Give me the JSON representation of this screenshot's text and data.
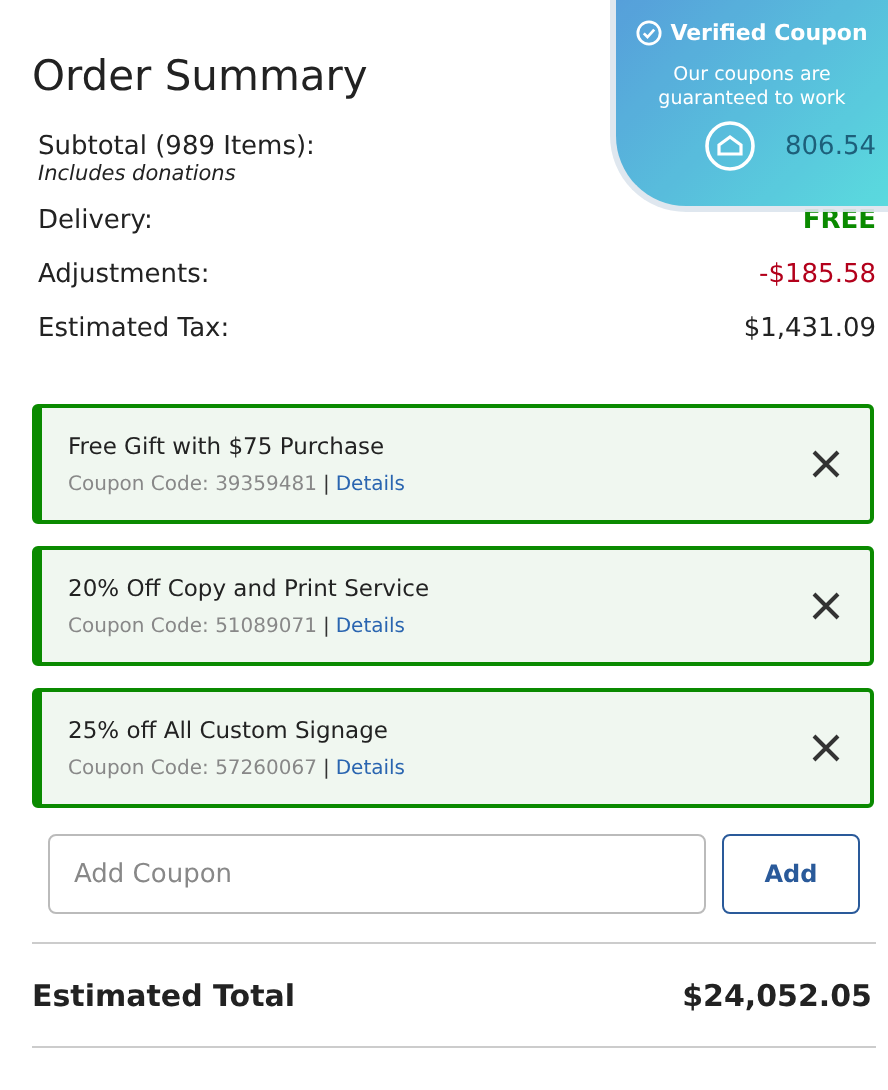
{
  "title": "Order Summary",
  "badge": {
    "title": "Verified Coupon",
    "text": "Our coupons are guaranteed to work"
  },
  "lines": [
    {
      "label": "Subtotal (989 Items):",
      "note": "Includes donations",
      "value": "806.54",
      "kind": "covered"
    },
    {
      "label": "Delivery:",
      "value": "FREE",
      "kind": "free"
    },
    {
      "label": "Adjustments:",
      "value": "-$185.58",
      "kind": "discount"
    },
    {
      "label": "Estimated Tax:",
      "value": "$1,431.09",
      "kind": "normal"
    }
  ],
  "coupons": [
    {
      "name": "Free Gift with $75 Purchase",
      "code": "Coupon Code: 39359481",
      "sep": "|",
      "link": "Details"
    },
    {
      "name": "20% Off Copy and Print Service",
      "code": "Coupon Code: 51089071",
      "sep": "|",
      "link": "Details"
    },
    {
      "name": "25% off All Custom Signage",
      "code": "Coupon Code: 57260067",
      "sep": "|",
      "link": "Details"
    }
  ],
  "coupon_input": {
    "placeholder": "Add Coupon",
    "button": "Add"
  },
  "total": {
    "label": "Estimated Total",
    "value": "$24,052.05"
  }
}
